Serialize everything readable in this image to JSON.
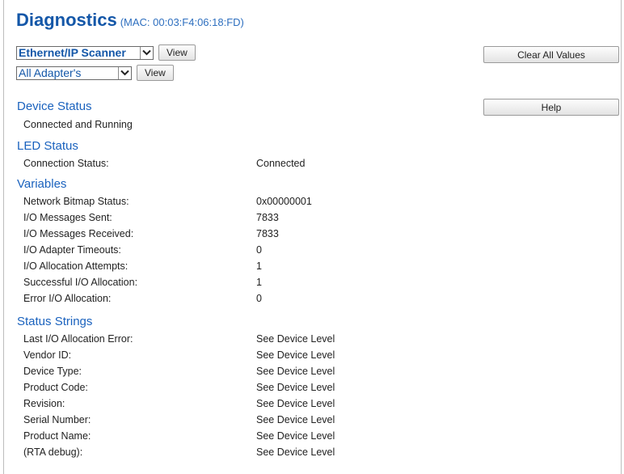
{
  "header": {
    "title": "Diagnostics",
    "mac": "(MAC: 00:03:F4:06:18:FD)"
  },
  "selectors": {
    "scanner": {
      "value": "Ethernet/IP Scanner",
      "button": "View"
    },
    "adapter": {
      "value": "All Adapter's",
      "button": "View"
    }
  },
  "actions": {
    "clear_all": "Clear All Values",
    "help": "Help"
  },
  "device_status": {
    "title": "Device Status",
    "text": "Connected and Running"
  },
  "led_status": {
    "title": "LED Status",
    "rows": [
      {
        "label": "Connection Status:",
        "value": "Connected"
      }
    ]
  },
  "variables": {
    "title": "Variables",
    "rows": [
      {
        "label": "Network Bitmap Status:",
        "value": "0x00000001"
      },
      {
        "label": "I/O Messages Sent:",
        "value": "7833"
      },
      {
        "label": "I/O Messages Received:",
        "value": "7833"
      },
      {
        "label": "I/O Adapter Timeouts:",
        "value": "0"
      },
      {
        "label": "I/O Allocation Attempts:",
        "value": "1"
      },
      {
        "label": "Successful I/O Allocation:",
        "value": "1"
      },
      {
        "label": "Error I/O Allocation:",
        "value": "0"
      }
    ]
  },
  "status_strings": {
    "title": "Status Strings",
    "rows": [
      {
        "label": "Last I/O Allocation Error:",
        "value": "See Device Level"
      },
      {
        "label": "Vendor ID:",
        "value": "See Device Level"
      },
      {
        "label": "Device Type:",
        "value": "See Device Level"
      },
      {
        "label": "Product Code:",
        "value": "See Device Level"
      },
      {
        "label": "Revision:",
        "value": "See Device Level"
      },
      {
        "label": "Serial Number:",
        "value": "See Device Level"
      },
      {
        "label": "Product Name:",
        "value": "See Device Level"
      },
      {
        "label": "(RTA debug):",
        "value": "See Device Level"
      }
    ]
  }
}
